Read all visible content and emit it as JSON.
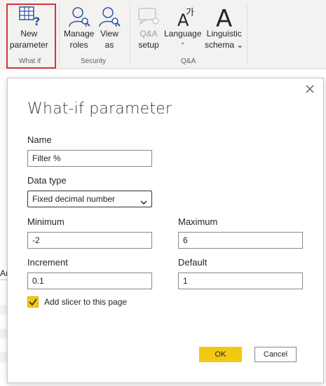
{
  "ribbon": {
    "buttons": {
      "new_parameter": {
        "line1": "New",
        "line2": "parameter"
      },
      "manage_roles": {
        "line1": "Manage",
        "line2": "roles"
      },
      "view_as": {
        "line1": "View",
        "line2": "as"
      },
      "qa_setup": {
        "line1": "Q&A",
        "line2": "setup"
      },
      "language": {
        "line1": "Language",
        "chevron": "⌄"
      },
      "linguistic_schema": {
        "line1": "Linguistic",
        "line2": "schema"
      }
    },
    "groups": {
      "whatif": "What if",
      "security": "Security",
      "qa": "Q&A"
    },
    "icons": {
      "new_parameter": "table-question-icon",
      "manage_roles": "user-magnify-icon",
      "view_as": "user-magnify-icon",
      "qa_setup": "chat-gear-icon",
      "language": "language-letters-icon",
      "linguistic_schema": "letter-a-icon"
    }
  },
  "background": {
    "fragment_text": "Ar"
  },
  "dialog": {
    "title": "What-if parameter",
    "name_label": "Name",
    "name_value": "Filter %",
    "data_type_label": "Data type",
    "data_type_value": "Fixed decimal number",
    "minimum_label": "Minimum",
    "minimum_value": "-2",
    "maximum_label": "Maximum",
    "maximum_value": "6",
    "increment_label": "Increment",
    "increment_value": "0.1",
    "default_label": "Default",
    "default_value": "1",
    "slicer_label": "Add slicer to this page",
    "slicer_checked": true,
    "ok_label": "OK",
    "cancel_label": "Cancel"
  },
  "colors": {
    "accent": "#f2c811",
    "highlight_border": "#d13438",
    "icon_blue": "#2b579a"
  }
}
